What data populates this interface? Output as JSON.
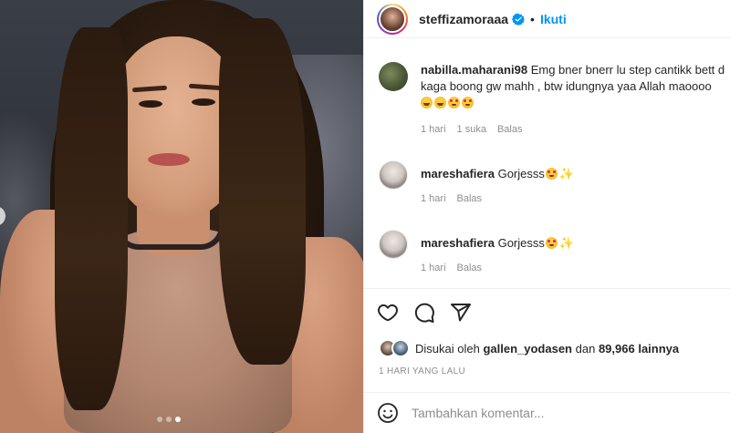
{
  "post": {
    "image_alt": "",
    "carousel": {
      "count": 3,
      "active": 3
    }
  },
  "header": {
    "username": "steffizamoraaa",
    "separator": "•",
    "follow_label": "Ikuti"
  },
  "comments": [
    {
      "username": "nabilla.maharani98",
      "line1": "Emg bner bnerr lu step cantikk bett d",
      "line2": "kaga boong gw mahh , btw idungnya yaa Allah maoooo",
      "emojis": [
        "laugh",
        "laugh",
        "heart-eyes",
        "heart-eyes"
      ],
      "time": "1 hari",
      "likes": "1 suka",
      "reply": "Balas"
    },
    {
      "username": "mareshafiera",
      "text": "Gorjesss",
      "emojis": [
        "heart-eyes",
        "sparkles"
      ],
      "time": "1 hari",
      "reply": "Balas"
    },
    {
      "username": "mareshafiera",
      "text": "Gorjesss",
      "emojis": [
        "heart-eyes",
        "sparkles"
      ],
      "time": "1 hari",
      "reply": "Balas"
    }
  ],
  "actions": {
    "icons": [
      "heart-icon",
      "comment-icon",
      "share-icon"
    ]
  },
  "likes": {
    "prefix": "Disukai oleh",
    "first_user": "gallen_yodasen",
    "conjunction": "dan",
    "others": "89,966 lainnya"
  },
  "timestamp": "1 HARI YANG LALU",
  "add_comment": {
    "placeholder": "Tambahkan komentar..."
  },
  "colors": {
    "accent": "#0095f6",
    "muted": "#8e8e8e",
    "text": "#262626",
    "border": "#efefef"
  }
}
